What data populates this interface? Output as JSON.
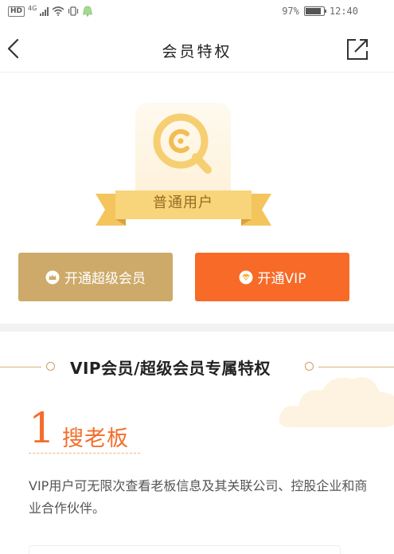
{
  "status_bar": {
    "hd": "HD",
    "network": "4G",
    "battery_percent": "97%",
    "battery_level": 0.97,
    "time": "12:40"
  },
  "nav": {
    "title": "会员特权",
    "back_icon": "chevron-left-icon",
    "share_icon": "share-external-icon"
  },
  "membership": {
    "level_label": "普通用户",
    "logo_icon": "c-search-logo-icon"
  },
  "actions": {
    "super_member_label": "开通超级会员",
    "super_member_icon": "crown-icon",
    "vip_label": "开通VIP",
    "vip_icon": "vip-diamond-icon"
  },
  "privileges": {
    "section_title": "VIP会员/超级会员专属特权",
    "items": [
      {
        "number": "1",
        "title": "搜老板",
        "description": "VIP用户可无限次查看老板信息及其关联公司、控股企业和商业合作伙伴。"
      }
    ]
  },
  "colors": {
    "gold": "#cdaa6a",
    "orange": "#f76a27",
    "ribbon": "#f6cf73"
  }
}
